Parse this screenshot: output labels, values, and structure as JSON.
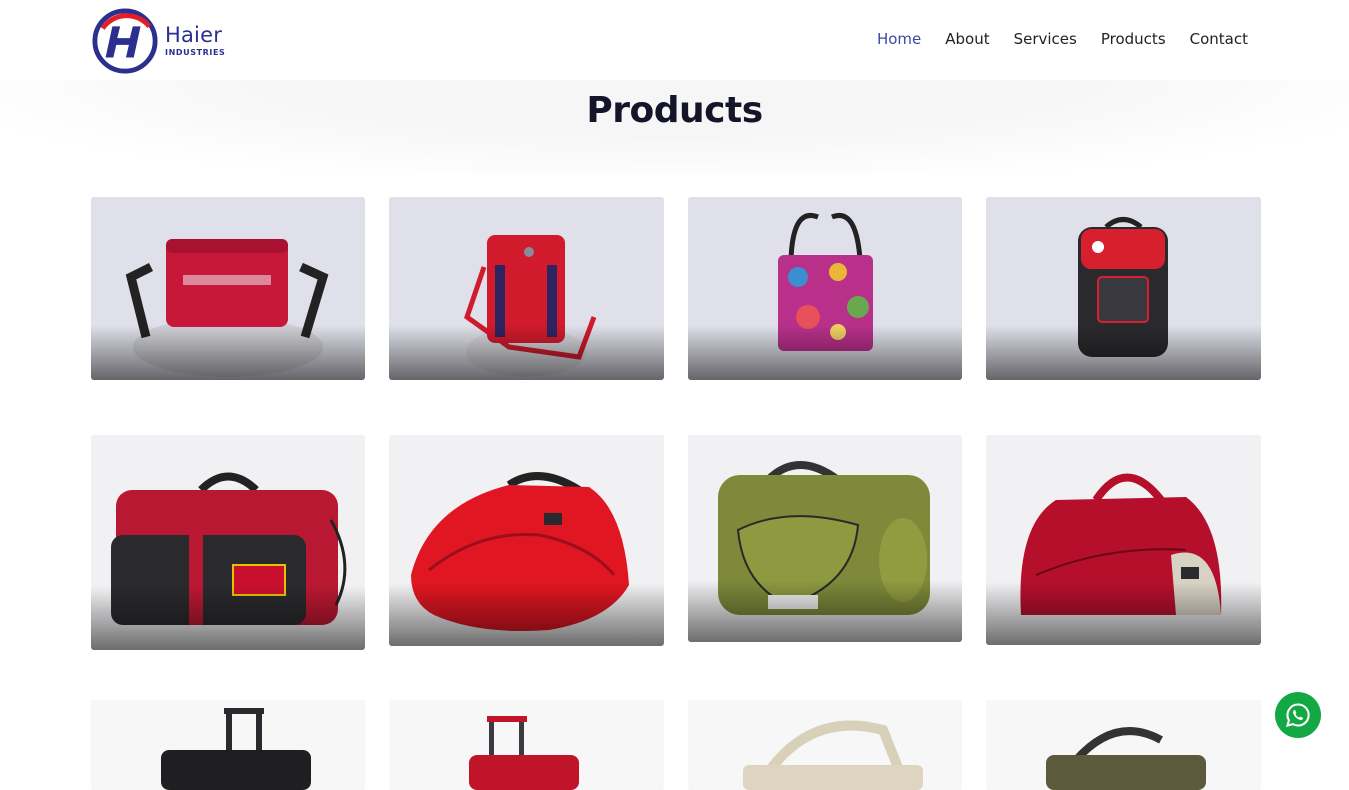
{
  "brand": {
    "name": "Haier",
    "sub": "INDUSTRIES"
  },
  "nav": [
    {
      "label": "Home",
      "active": true
    },
    {
      "label": "About",
      "active": false
    },
    {
      "label": "Services",
      "active": false
    },
    {
      "label": "Products",
      "active": false
    },
    {
      "label": "Contact",
      "active": false
    }
  ],
  "page": {
    "title": "Products"
  },
  "products": [
    {
      "item": "red shoulder bag",
      "color": "#c8183a"
    },
    {
      "item": "red sling bag",
      "color": "#d11a2c"
    },
    {
      "item": "printed tote lunch bag",
      "color": "#b8308a"
    },
    {
      "item": "black red backpack",
      "color": "#2a2a2e"
    },
    {
      "item": "red black duffel bag",
      "color": "#b81832"
    },
    {
      "item": "red round duffel bag",
      "color": "#e01622"
    },
    {
      "item": "olive green duffel bag",
      "color": "#7e8a3a"
    },
    {
      "item": "red grey duffel bag",
      "color": "#b50f2c"
    },
    {
      "item": "trolley bag black",
      "color": "#1f1f22"
    },
    {
      "item": "trolley bag red",
      "color": "#c0142a"
    },
    {
      "item": "cream tote bag",
      "color": "#d8d0b8"
    },
    {
      "item": "olive duffel bag",
      "color": "#5c5a3c"
    }
  ],
  "colors": {
    "nav_active": "#3d4aa3",
    "brand_blue": "#2b2f8f",
    "brand_red": "#e21f26",
    "whatsapp": "#14a845"
  }
}
